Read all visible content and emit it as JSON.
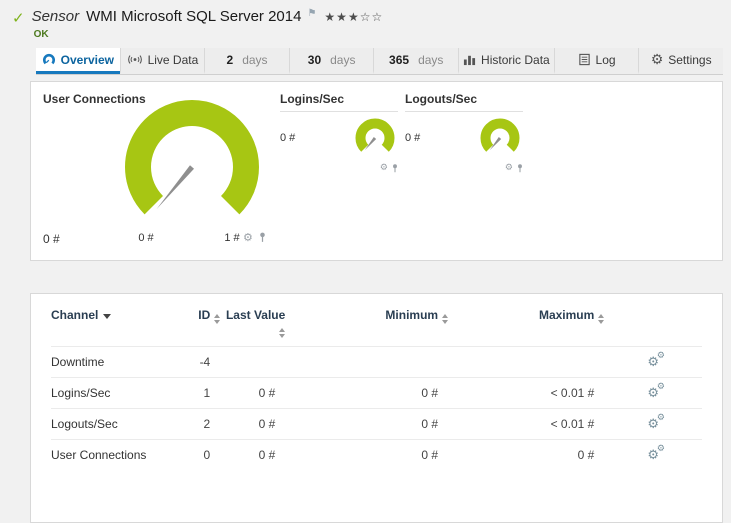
{
  "header": {
    "check_icon": "✓",
    "kind": "Sensor",
    "title": "WMI Microsoft SQL Server 2014",
    "flag_icon": "⚑",
    "stars": "★★★☆☆",
    "status": "OK"
  },
  "tabs": {
    "overview": "Overview",
    "live_data": "Live Data",
    "d2_num": "2",
    "d2_unit": "days",
    "d30_num": "30",
    "d30_unit": "days",
    "d365_num": "365",
    "d365_unit": "days",
    "historic": "Historic Data",
    "log": "Log",
    "settings": "Settings"
  },
  "gauges": {
    "main": {
      "title": "User Connections",
      "current_value": "0 #",
      "scale_min": "0 #",
      "scale_max": "1 #"
    },
    "logins": {
      "title": "Logins/Sec",
      "value": "0 #"
    },
    "logouts": {
      "title": "Logouts/Sec",
      "value": "0 #"
    }
  },
  "table": {
    "headers": {
      "channel": "Channel",
      "id": "ID",
      "last_value": "Last Value",
      "minimum": "Minimum",
      "maximum": "Maximum"
    },
    "rows": [
      {
        "channel": "Downtime",
        "id": "-4",
        "last_value": "",
        "minimum": "",
        "maximum": ""
      },
      {
        "channel": "Logins/Sec",
        "id": "1",
        "last_value": "0 #",
        "minimum": "0 #",
        "maximum": "< 0.01 #"
      },
      {
        "channel": "Logouts/Sec",
        "id": "2",
        "last_value": "0 #",
        "minimum": "0 #",
        "maximum": "< 0.01 #"
      },
      {
        "channel": "User Connections",
        "id": "0",
        "last_value": "0 #",
        "minimum": "0 #",
        "maximum": "0 #"
      }
    ]
  },
  "icons": {
    "gear": "⚙"
  },
  "colors": {
    "gauge_green": "#a7c613",
    "accent_blue": "#1779be",
    "status_ok_green": "#4d7a1f",
    "needle_gray": "#8f8f8f"
  }
}
